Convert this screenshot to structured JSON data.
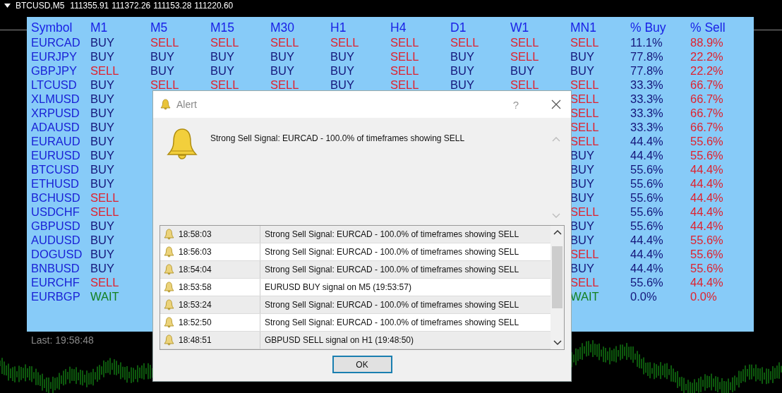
{
  "chart_header": {
    "symbol": "BTCUSD,M5",
    "prices": [
      "111355.91",
      "111372.26",
      "111153.28",
      "111220.60"
    ]
  },
  "panel": {
    "columns": [
      "Symbol",
      "M1",
      "M5",
      "M15",
      "M30",
      "H1",
      "H4",
      "D1",
      "W1",
      "MN1",
      "% Buy",
      "% Sell"
    ],
    "rows": [
      [
        {
          "text": "EURCAD",
          "kind": "symbol"
        },
        {
          "text": "BUY",
          "kind": "buy"
        },
        {
          "text": "SELL",
          "kind": "sell"
        },
        {
          "text": "SELL",
          "kind": "sell"
        },
        {
          "text": "SELL",
          "kind": "sell"
        },
        {
          "text": "SELL",
          "kind": "sell"
        },
        {
          "text": "SELL",
          "kind": "sell"
        },
        {
          "text": "SELL",
          "kind": "sell"
        },
        {
          "text": "SELL",
          "kind": "sell"
        },
        {
          "text": "SELL",
          "kind": "sell"
        },
        {
          "text": "11.1%",
          "kind": "buy"
        },
        {
          "text": "88.9%",
          "kind": "sell"
        }
      ],
      [
        {
          "text": "EURJPY",
          "kind": "symbol"
        },
        {
          "text": "BUY",
          "kind": "buy"
        },
        {
          "text": "BUY",
          "kind": "buy"
        },
        {
          "text": "BUY",
          "kind": "buy"
        },
        {
          "text": "BUY",
          "kind": "buy"
        },
        {
          "text": "BUY",
          "kind": "buy"
        },
        {
          "text": "SELL",
          "kind": "sell"
        },
        {
          "text": "BUY",
          "kind": "buy"
        },
        {
          "text": "SELL",
          "kind": "sell"
        },
        {
          "text": "BUY",
          "kind": "buy"
        },
        {
          "text": "77.8%",
          "kind": "buy"
        },
        {
          "text": "22.2%",
          "kind": "sell"
        }
      ],
      [
        {
          "text": "GBPJPY",
          "kind": "symbol"
        },
        {
          "text": "SELL",
          "kind": "sell"
        },
        {
          "text": "BUY",
          "kind": "buy"
        },
        {
          "text": "BUY",
          "kind": "buy"
        },
        {
          "text": "BUY",
          "kind": "buy"
        },
        {
          "text": "BUY",
          "kind": "buy"
        },
        {
          "text": "SELL",
          "kind": "sell"
        },
        {
          "text": "BUY",
          "kind": "buy"
        },
        {
          "text": "BUY",
          "kind": "buy"
        },
        {
          "text": "BUY",
          "kind": "buy"
        },
        {
          "text": "77.8%",
          "kind": "buy"
        },
        {
          "text": "22.2%",
          "kind": "sell"
        }
      ],
      [
        {
          "text": "LTCUSD",
          "kind": "symbol"
        },
        {
          "text": "BUY",
          "kind": "buy"
        },
        {
          "text": "SELL",
          "kind": "sell"
        },
        {
          "text": "SELL",
          "kind": "sell"
        },
        {
          "text": "SELL",
          "kind": "sell"
        },
        {
          "text": "BUY",
          "kind": "buy"
        },
        {
          "text": "SELL",
          "kind": "sell"
        },
        {
          "text": "BUY",
          "kind": "buy"
        },
        {
          "text": "SELL",
          "kind": "sell"
        },
        {
          "text": "SELL",
          "kind": "sell"
        },
        {
          "text": "33.3%",
          "kind": "buy"
        },
        {
          "text": "66.7%",
          "kind": "sell"
        }
      ],
      [
        {
          "text": "XLMUSD",
          "kind": "symbol"
        },
        {
          "text": "BUY",
          "kind": "buy"
        },
        null,
        null,
        null,
        null,
        null,
        null,
        null,
        {
          "text": "SELL",
          "kind": "sell"
        },
        {
          "text": "33.3%",
          "kind": "buy"
        },
        {
          "text": "66.7%",
          "kind": "sell"
        }
      ],
      [
        {
          "text": "XRPUSD",
          "kind": "symbol"
        },
        {
          "text": "BUY",
          "kind": "buy"
        },
        null,
        null,
        null,
        null,
        null,
        null,
        null,
        {
          "text": "SELL",
          "kind": "sell"
        },
        {
          "text": "33.3%",
          "kind": "buy"
        },
        {
          "text": "66.7%",
          "kind": "sell"
        }
      ],
      [
        {
          "text": "ADAUSD",
          "kind": "symbol"
        },
        {
          "text": "BUY",
          "kind": "buy"
        },
        null,
        null,
        null,
        null,
        null,
        null,
        null,
        {
          "text": "SELL",
          "kind": "sell"
        },
        {
          "text": "33.3%",
          "kind": "buy"
        },
        {
          "text": "66.7%",
          "kind": "sell"
        }
      ],
      [
        {
          "text": "EURAUD",
          "kind": "symbol"
        },
        {
          "text": "BUY",
          "kind": "buy"
        },
        null,
        null,
        null,
        null,
        null,
        null,
        null,
        {
          "text": "SELL",
          "kind": "sell"
        },
        {
          "text": "44.4%",
          "kind": "buy"
        },
        {
          "text": "55.6%",
          "kind": "sell"
        }
      ],
      [
        {
          "text": "EURUSD",
          "kind": "symbol"
        },
        {
          "text": "BUY",
          "kind": "buy"
        },
        null,
        null,
        null,
        null,
        null,
        null,
        null,
        {
          "text": "BUY",
          "kind": "buy"
        },
        {
          "text": "44.4%",
          "kind": "buy"
        },
        {
          "text": "55.6%",
          "kind": "sell"
        }
      ],
      [
        {
          "text": "BTCUSD",
          "kind": "symbol"
        },
        {
          "text": "BUY",
          "kind": "buy"
        },
        null,
        null,
        null,
        null,
        null,
        null,
        null,
        {
          "text": "BUY",
          "kind": "buy"
        },
        {
          "text": "55.6%",
          "kind": "buy"
        },
        {
          "text": "44.4%",
          "kind": "sell"
        }
      ],
      [
        {
          "text": "ETHUSD",
          "kind": "symbol"
        },
        {
          "text": "BUY",
          "kind": "buy"
        },
        null,
        null,
        null,
        null,
        null,
        null,
        null,
        {
          "text": "BUY",
          "kind": "buy"
        },
        {
          "text": "55.6%",
          "kind": "buy"
        },
        {
          "text": "44.4%",
          "kind": "sell"
        }
      ],
      [
        {
          "text": "BCHUSD",
          "kind": "symbol"
        },
        {
          "text": "SELL",
          "kind": "sell"
        },
        null,
        null,
        null,
        null,
        null,
        null,
        null,
        {
          "text": "BUY",
          "kind": "buy"
        },
        {
          "text": "55.6%",
          "kind": "buy"
        },
        {
          "text": "44.4%",
          "kind": "sell"
        }
      ],
      [
        {
          "text": "USDCHF",
          "kind": "symbol"
        },
        {
          "text": "SELL",
          "kind": "sell"
        },
        null,
        null,
        null,
        null,
        null,
        null,
        null,
        {
          "text": "SELL",
          "kind": "sell"
        },
        {
          "text": "55.6%",
          "kind": "buy"
        },
        {
          "text": "44.4%",
          "kind": "sell"
        }
      ],
      [
        {
          "text": "GBPUSD",
          "kind": "symbol"
        },
        {
          "text": "BUY",
          "kind": "buy"
        },
        null,
        null,
        null,
        null,
        null,
        null,
        null,
        {
          "text": "BUY",
          "kind": "buy"
        },
        {
          "text": "55.6%",
          "kind": "buy"
        },
        {
          "text": "44.4%",
          "kind": "sell"
        }
      ],
      [
        {
          "text": "AUDUSD",
          "kind": "symbol"
        },
        {
          "text": "BUY",
          "kind": "buy"
        },
        null,
        null,
        null,
        null,
        null,
        null,
        null,
        {
          "text": "BUY",
          "kind": "buy"
        },
        {
          "text": "44.4%",
          "kind": "buy"
        },
        {
          "text": "55.6%",
          "kind": "sell"
        }
      ],
      [
        {
          "text": "DOGUSD",
          "kind": "symbol"
        },
        {
          "text": "BUY",
          "kind": "buy"
        },
        null,
        null,
        null,
        null,
        null,
        null,
        null,
        {
          "text": "SELL",
          "kind": "sell"
        },
        {
          "text": "44.4%",
          "kind": "buy"
        },
        {
          "text": "55.6%",
          "kind": "sell"
        }
      ],
      [
        {
          "text": "BNBUSD",
          "kind": "symbol"
        },
        {
          "text": "BUY",
          "kind": "buy"
        },
        null,
        null,
        null,
        null,
        null,
        null,
        null,
        {
          "text": "BUY",
          "kind": "buy"
        },
        {
          "text": "44.4%",
          "kind": "buy"
        },
        {
          "text": "55.6%",
          "kind": "sell"
        }
      ],
      [
        {
          "text": "EURCHF",
          "kind": "symbol"
        },
        {
          "text": "SELL",
          "kind": "sell"
        },
        null,
        null,
        null,
        null,
        null,
        null,
        null,
        {
          "text": "SELL",
          "kind": "sell"
        },
        {
          "text": "55.6%",
          "kind": "buy"
        },
        {
          "text": "44.4%",
          "kind": "sell"
        }
      ],
      [
        {
          "text": "EURBGP",
          "kind": "symbol"
        },
        {
          "text": "WAIT",
          "kind": "wait"
        },
        null,
        null,
        null,
        null,
        null,
        null,
        null,
        {
          "text": "WAIT",
          "kind": "wait"
        },
        {
          "text": "0.0%",
          "kind": "buy"
        },
        {
          "text": "0.0%",
          "kind": "sell"
        }
      ]
    ]
  },
  "last_update": "Last: 19:58:48",
  "dialog": {
    "title": "Alert",
    "help": "?",
    "message": "Strong Sell Signal: EURCAD - 100.0% of timeframes showing SELL",
    "log": [
      {
        "time": "18:58:03",
        "text": "Strong Sell Signal: EURCAD - 100.0% of timeframes showing SELL"
      },
      {
        "time": "18:56:03",
        "text": "Strong Sell Signal: EURCAD - 100.0% of timeframes showing SELL"
      },
      {
        "time": "18:54:04",
        "text": "Strong Sell Signal: EURCAD - 100.0% of timeframes showing SELL"
      },
      {
        "time": "18:53:58",
        "text": "EURUSD BUY signal on M5 (19:53:57)"
      },
      {
        "time": "18:53:24",
        "text": "Strong Sell Signal: EURCAD - 100.0% of timeframes showing SELL"
      },
      {
        "time": "18:52:50",
        "text": "Strong Sell Signal: EURCAD - 100.0% of timeframes showing SELL"
      },
      {
        "time": "18:48:51",
        "text": "GBPUSD SELL signal on H1 (19:48:50)"
      }
    ],
    "ok": "OK"
  }
}
